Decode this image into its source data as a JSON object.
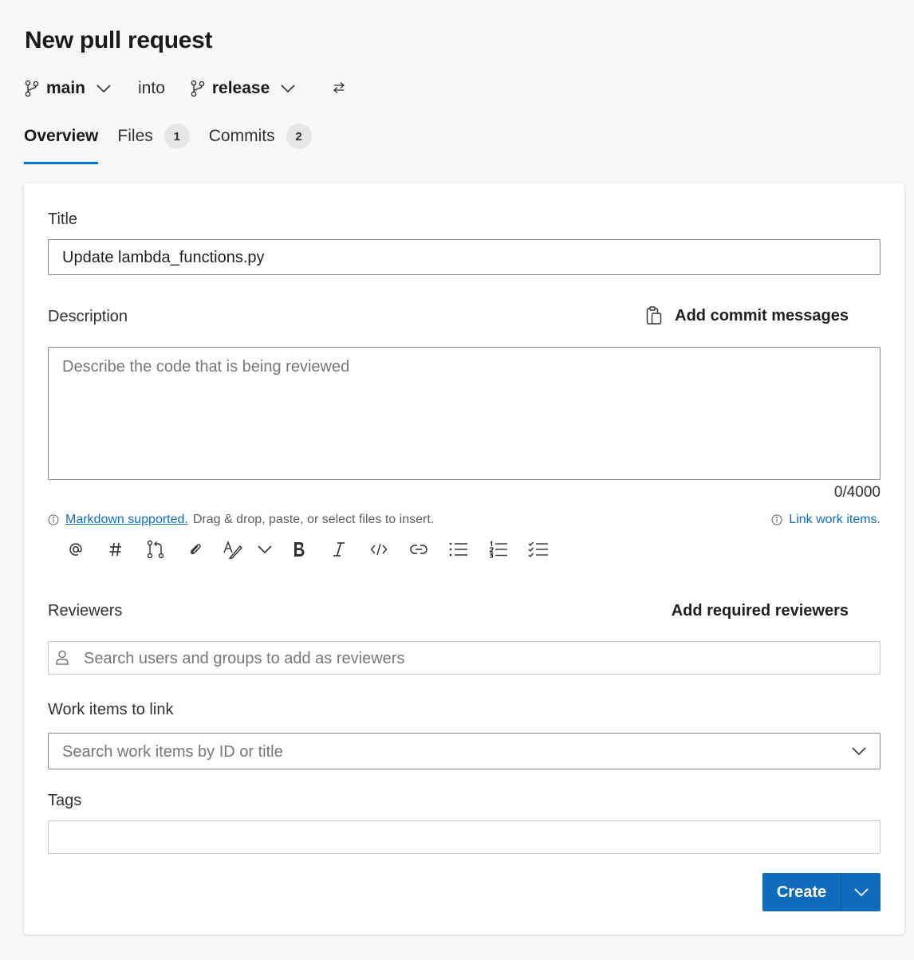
{
  "page": {
    "title": "New pull request"
  },
  "branches": {
    "source": "main",
    "into_text": "into",
    "target": "release"
  },
  "tabs": [
    {
      "label": "Overview",
      "active": true
    },
    {
      "label": "Files",
      "count": "1"
    },
    {
      "label": "Commits",
      "count": "2"
    }
  ],
  "form": {
    "title_label": "Title",
    "title_value": "Update lambda_functions.py",
    "description_label": "Description",
    "add_commit_messages": "Add commit messages",
    "description_placeholder": "Describe the code that is being reviewed",
    "char_counter": "0/4000",
    "markdown_link": "Markdown supported.",
    "markdown_hint": "Drag & drop, paste, or select files to insert.",
    "link_work_items": "Link work items.",
    "toolbar": [
      "mention-icon",
      "hashtag-icon",
      "pull-request-icon",
      "attach-icon",
      "format-text-icon",
      "chevron-down-icon",
      "bold-icon",
      "italic-icon",
      "code-icon",
      "link-icon",
      "bulleted-list-icon",
      "numbered-list-icon",
      "checklist-icon"
    ],
    "reviewers_label": "Reviewers",
    "add_required_reviewers": "Add required reviewers",
    "reviewers_placeholder": "Search users and groups to add as reviewers",
    "work_items_label": "Work items to link",
    "work_items_placeholder": "Search work items by ID or title",
    "tags_label": "Tags",
    "create_label": "Create"
  },
  "colors": {
    "accent": "#0f6cbd",
    "tab_underline": "#0078d4",
    "background": "#f8f8f8"
  }
}
